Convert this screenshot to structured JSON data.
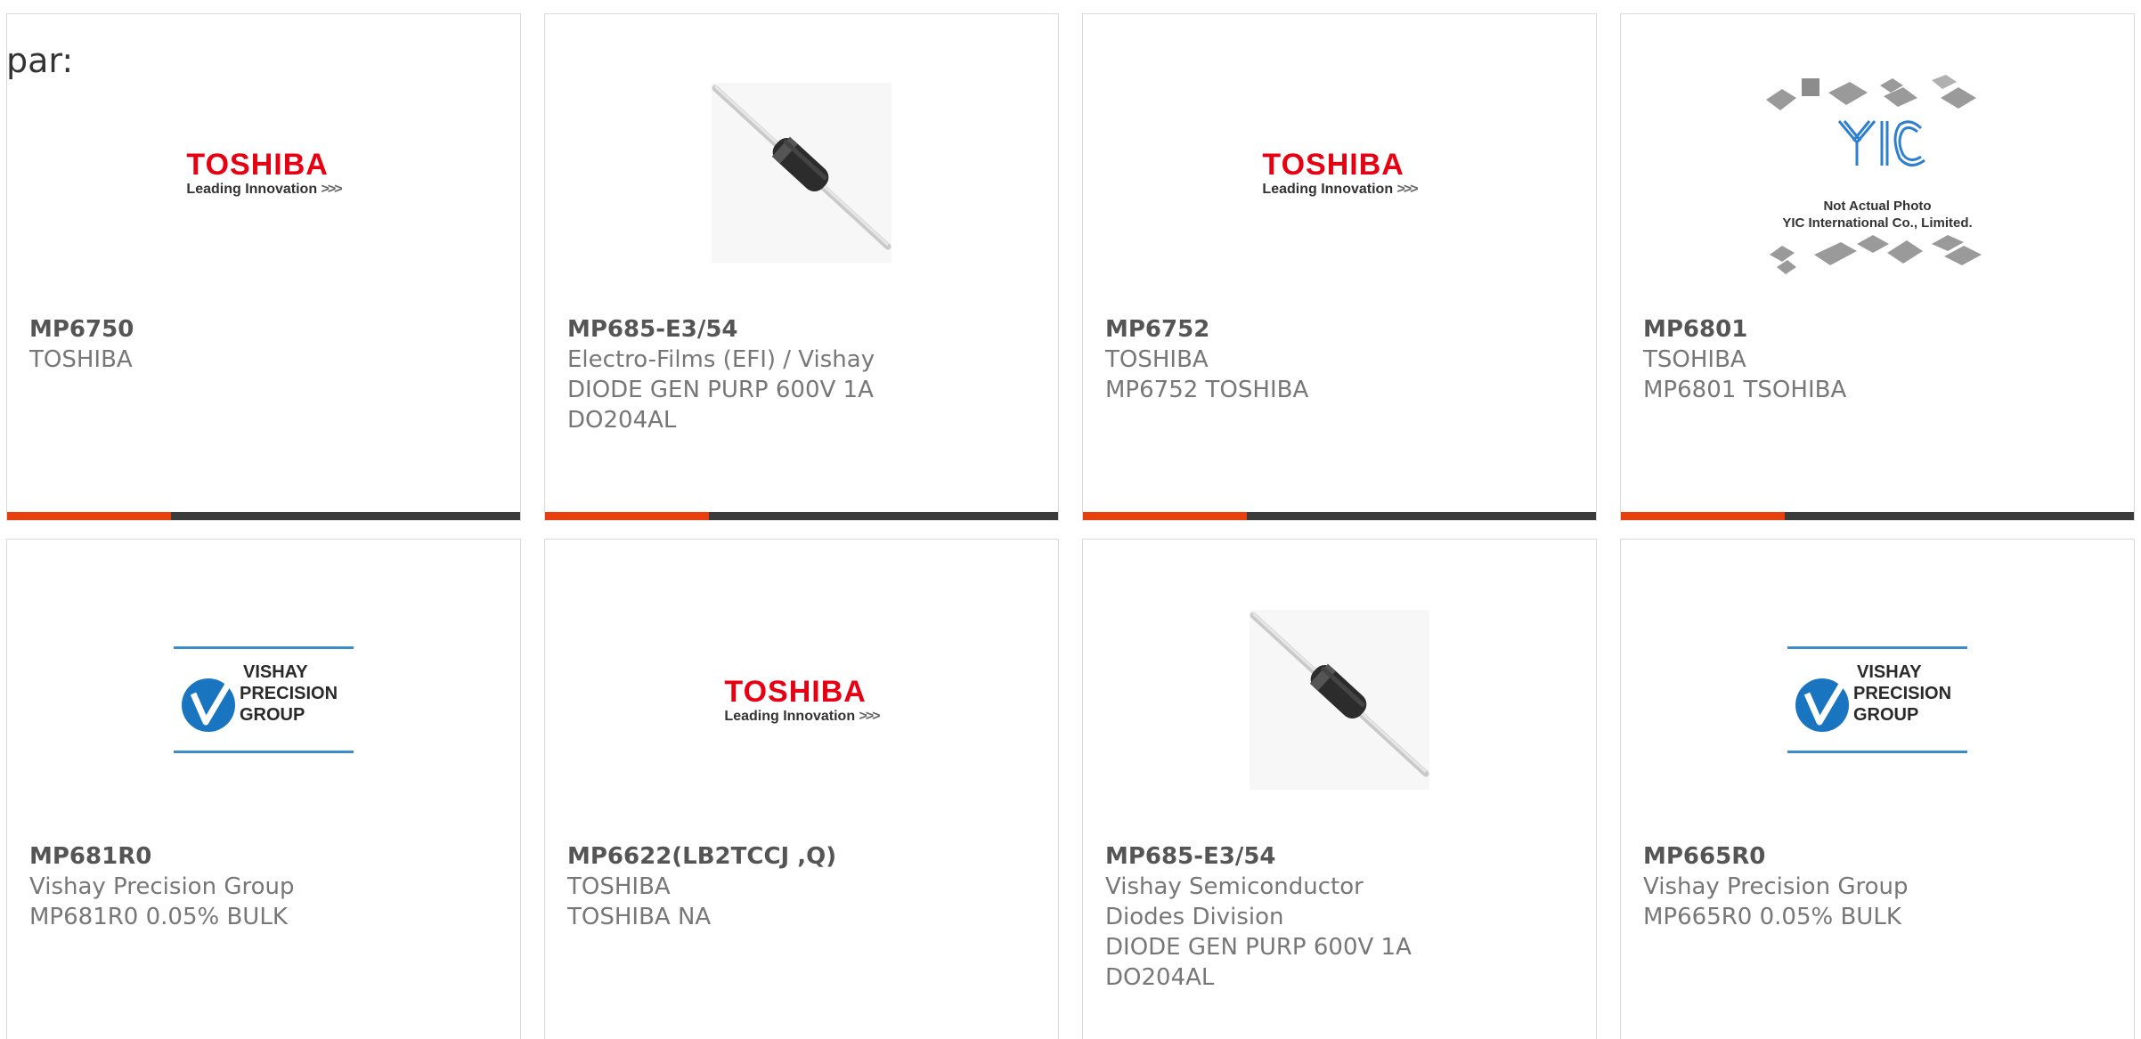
{
  "header": {
    "prefix": "par:"
  },
  "colors": {
    "accent": "#e8400c",
    "bar": "#3b3b3b",
    "toshiba_red": "#e60012",
    "vishay_blue": "#1a75c1"
  },
  "products": [
    {
      "part": "MP6750",
      "manufacturer": "TOSHIBA",
      "description": "",
      "image": "toshiba-logo"
    },
    {
      "part": "MP685-E3/54",
      "manufacturer": "Electro-Films (EFI) / Vishay",
      "description": "DIODE GEN PURP 600V 1A DO204AL",
      "image": "axial-diode-photo"
    },
    {
      "part": "MP6752",
      "manufacturer": "TOSHIBA",
      "description": "MP6752 TOSHIBA",
      "image": "toshiba-logo"
    },
    {
      "part": "MP6801",
      "manufacturer": "TSOHIBA",
      "description": "MP6801 TSOHIBA",
      "image": "yic-placeholder"
    },
    {
      "part": "MP681R0",
      "manufacturer": "Vishay Precision Group",
      "description": "MP681R0 0.05% BULK",
      "image": "vishay-precision-logo"
    },
    {
      "part": "MP6622(LB2TCCJ ,Q)",
      "manufacturer": "TOSHIBA",
      "description": "TOSHIBA NA",
      "image": "toshiba-logo"
    },
    {
      "part": "MP685-E3/54",
      "manufacturer": "Vishay Semiconductor Diodes Division",
      "description": "DIODE GEN PURP 600V 1A DO204AL",
      "image": "axial-diode-photo"
    },
    {
      "part": "MP665R0",
      "manufacturer": "Vishay Precision Group",
      "description": "MP665R0 0.05% BULK",
      "image": "vishay-precision-logo"
    }
  ],
  "logos": {
    "toshiba": {
      "name": "TOSHIBA",
      "tagline": "Leading Innovation",
      "arrows": ">>>"
    },
    "vishay": {
      "line1": "VISHAY",
      "line2": "PRECISION",
      "line3": "GROUP"
    },
    "yic": {
      "mark": "YIC",
      "line1": "Not Actual Photo",
      "line2": "YIC International Co., Limited."
    }
  }
}
